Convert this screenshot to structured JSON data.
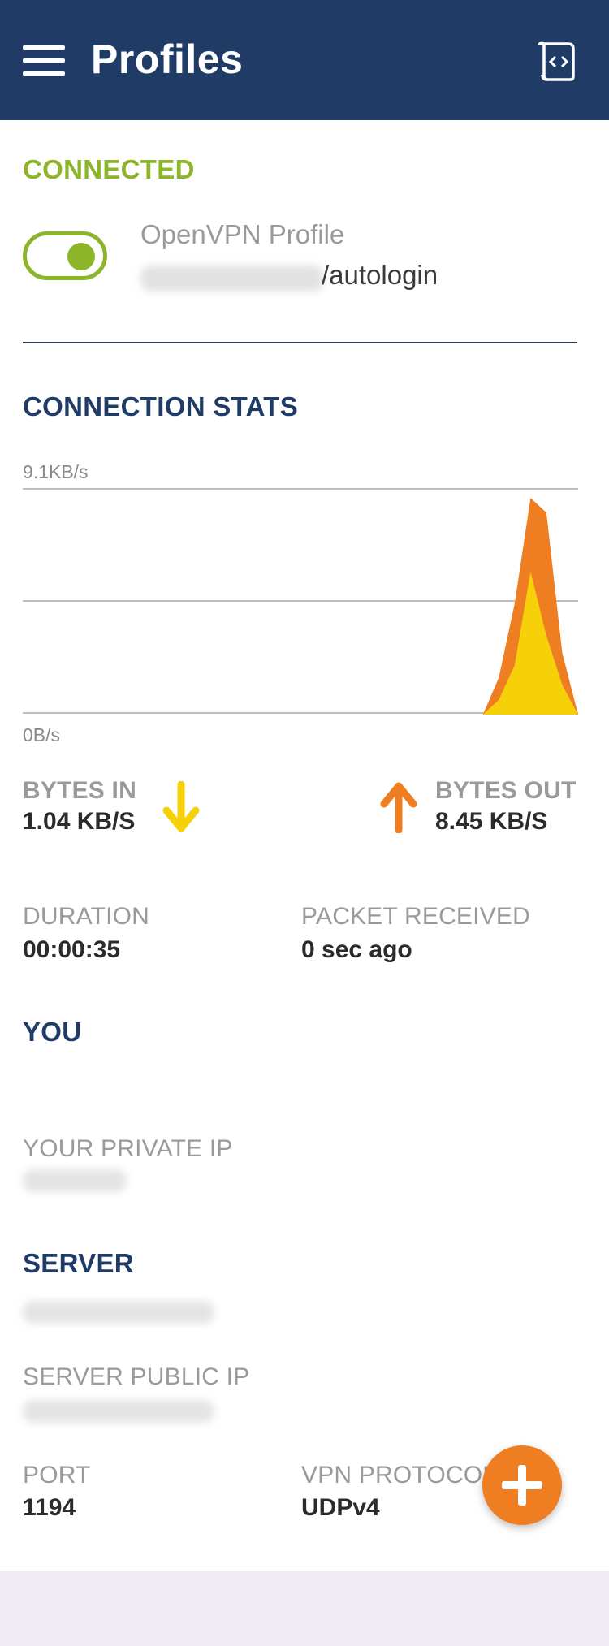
{
  "header": {
    "title": "Profiles",
    "menu_icon": "hamburger-menu-icon",
    "import_icon": "import-profile-icon",
    "background_color": "#1f3b66"
  },
  "status": {
    "label": "CONNECTED",
    "color": "#8db52a",
    "toggle_on": true,
    "profile_name": "OpenVPN Profile",
    "profile_user_suffix": "/autologin"
  },
  "stats": {
    "title": "CONNECTION STATS",
    "bytes_in_label": "BYTES IN",
    "bytes_in_value": "1.04 KB/S",
    "bytes_out_label": "BYTES OUT",
    "bytes_out_value": "8.45 KB/S",
    "duration_label": "DURATION",
    "duration_value": "00:00:35",
    "packet_label": "PACKET RECEIVED",
    "packet_value": "0 sec ago",
    "in_color": "#f6d10a",
    "out_color": "#ef7d22"
  },
  "chart_data": {
    "type": "area",
    "title": "",
    "ytick_max": "9.1KB/s",
    "ytick_min": "0B/s",
    "ylim": [
      0,
      9.1
    ],
    "grid": true,
    "series": [
      {
        "values": [
          0,
          0,
          0,
          0,
          0,
          0,
          0,
          0,
          0,
          0,
          0,
          0,
          0,
          0,
          0,
          0,
          0,
          0,
          0,
          0,
          0,
          0,
          0,
          0,
          0,
          0,
          0,
          0,
          0,
          0,
          1.5,
          4.5,
          8.8,
          8.2,
          2.5,
          0
        ],
        "color": "#ef7d22"
      },
      {
        "values": [
          0,
          0,
          0,
          0,
          0,
          0,
          0,
          0,
          0,
          0,
          0,
          0,
          0,
          0,
          0,
          0,
          0,
          0,
          0,
          0,
          0,
          0,
          0,
          0,
          0,
          0,
          0,
          0,
          0,
          0,
          0.6,
          2.0,
          5.8,
          3.2,
          1.2,
          0
        ],
        "color": "#f6d10a"
      }
    ]
  },
  "you": {
    "title": "YOU",
    "private_ip_label": "YOUR PRIVATE IP"
  },
  "server": {
    "title": "SERVER",
    "public_ip_label": "SERVER PUBLIC IP",
    "port_label": "PORT",
    "port_value": "1194",
    "protocol_label": "VPN PROTOCOL",
    "protocol_value": "UDPv4"
  },
  "fab": {
    "icon": "plus-icon",
    "color": "#ef7d22"
  }
}
